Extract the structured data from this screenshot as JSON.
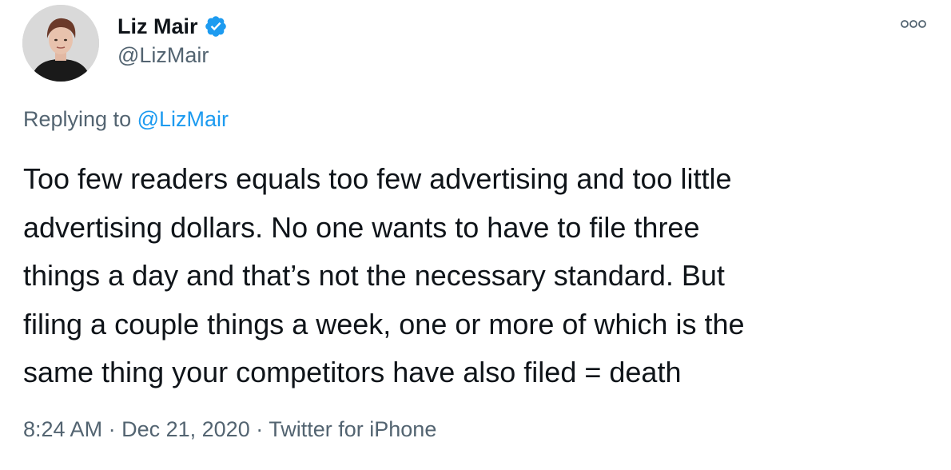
{
  "author": {
    "display_name": "Liz Mair",
    "handle": "@LizMair",
    "verified_icon": "verified-badge-icon",
    "avatar_icon": "profile-photo"
  },
  "menu": {
    "icon": "more-options-icon"
  },
  "reply_context": {
    "prefix": "Replying to",
    "mention": "@LizMair"
  },
  "tweet": {
    "lines": [
      "Too few readers equals too few advertising and too little",
      "advertising dollars. No one wants to have to file three",
      "things a day and that’s not the necessary standard. But",
      "filing a couple things a week, one or more of which is the",
      "same thing your competitors have also filed = death"
    ]
  },
  "meta": {
    "time": "8:24 AM",
    "separator": "·",
    "date": "Dec 21, 2020",
    "source": "Twitter for iPhone"
  },
  "colors": {
    "text": "#0f1419",
    "secondary": "#536471",
    "accent": "#1d9bf0"
  }
}
